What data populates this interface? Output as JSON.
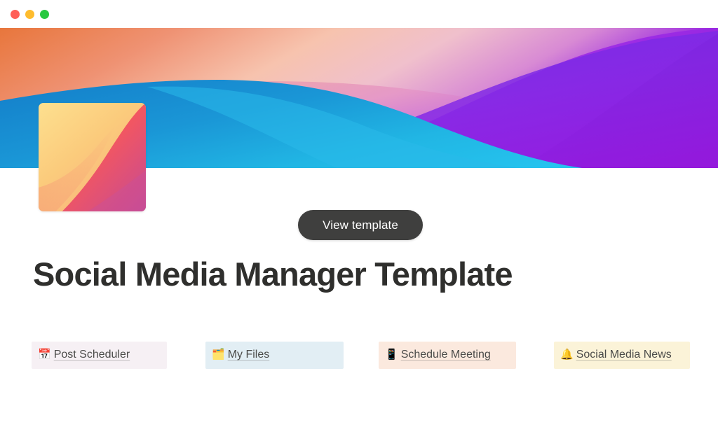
{
  "window": {
    "traffic_lights": [
      {
        "name": "close",
        "color": "#ff5f57"
      },
      {
        "name": "minimize",
        "color": "#febc2e"
      },
      {
        "name": "maximize",
        "color": "#28c840"
      }
    ]
  },
  "cover": {
    "icon_name": "page-cover-gradient-waves",
    "colors": {
      "orange": "#e87840",
      "peach": "#f6b79a",
      "blue": "#1b8fd1",
      "cyan": "#22b3e0",
      "pink": "#d77fc8",
      "violet": "#8b3fe0",
      "purple": "#8a12d8",
      "deep_purple": "#7a0fc4"
    }
  },
  "page_icon": {
    "icon_name": "page-icon-gradient-square",
    "colors": {
      "yellow": "#fcd980",
      "orange": "#f9a26c",
      "red": "#f4585f",
      "magenta": "#c64a96"
    }
  },
  "header": {
    "view_template_label": "View template",
    "title": "Social Media Manager Template"
  },
  "links": [
    {
      "emoji": "📅",
      "emoji_name": "calendar-icon",
      "label": "Post Scheduler",
      "background": "#f6f0f4"
    },
    {
      "emoji": "🗂️",
      "emoji_name": "card-index-dividers-icon",
      "label": "My Files",
      "background": "#e2eef4"
    },
    {
      "emoji": "📱",
      "emoji_name": "mobile-phone-icon",
      "label": "Schedule Meeting",
      "background": "#fbe9de"
    },
    {
      "emoji": "🔔",
      "emoji_name": "bell-icon",
      "label": "Social Media News",
      "background": "#fbf3d8"
    }
  ]
}
